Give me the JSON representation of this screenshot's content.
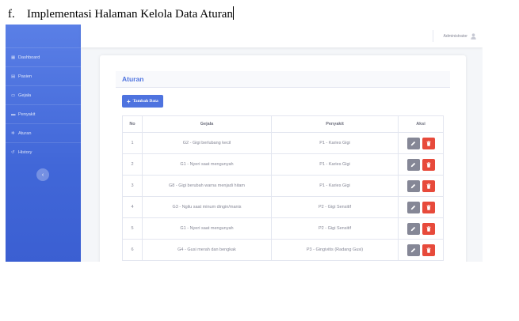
{
  "doc": {
    "number": "f.",
    "heading": "Implementasi Halaman Kelola Data Aturan"
  },
  "sidebar": {
    "items": [
      {
        "label": "Dashboard",
        "icon": "dashboard-icon"
      },
      {
        "label": "Pasien",
        "icon": "patient-icon"
      },
      {
        "label": "Gejala",
        "icon": "symptom-icon"
      },
      {
        "label": "Penyakit",
        "icon": "folder-icon"
      },
      {
        "label": "Aturan",
        "icon": "gear-icon"
      },
      {
        "label": "History",
        "icon": "history-icon"
      }
    ],
    "toggle_icon": "‹"
  },
  "topbar": {
    "user_name": "Administrator"
  },
  "main": {
    "card_title": "Aturan",
    "add_button": "Tambah Data",
    "table": {
      "headers": [
        "No",
        "Gejala",
        "Penyakit",
        "Aksi"
      ],
      "rows": [
        {
          "no": "1",
          "gejala": "G2 - Gigi berlubang kecil",
          "penyakit": "P1 - Karies Gigi"
        },
        {
          "no": "2",
          "gejala": "G1 - Nyeri saat mengunyah",
          "penyakit": "P1 - Karies Gigi"
        },
        {
          "no": "3",
          "gejala": "G8 - Gigi berubah warna menjadi hitam",
          "penyakit": "P1 - Karies Gigi"
        },
        {
          "no": "4",
          "gejala": "G3 - Ngilu saat minum dingin/manis",
          "penyakit": "P2 - Gigi Sensitif"
        },
        {
          "no": "5",
          "gejala": "G1 - Nyeri saat mengunyah",
          "penyakit": "P2 - Gigi Sensitif"
        },
        {
          "no": "6",
          "gejala": "G4 - Gusi merah dan bengkak",
          "penyakit": "P3 - Gingivitis (Radang Gusi)"
        }
      ]
    }
  },
  "colors": {
    "primary": "#4e73df",
    "danger": "#e74a3b",
    "secondary": "#858796"
  }
}
